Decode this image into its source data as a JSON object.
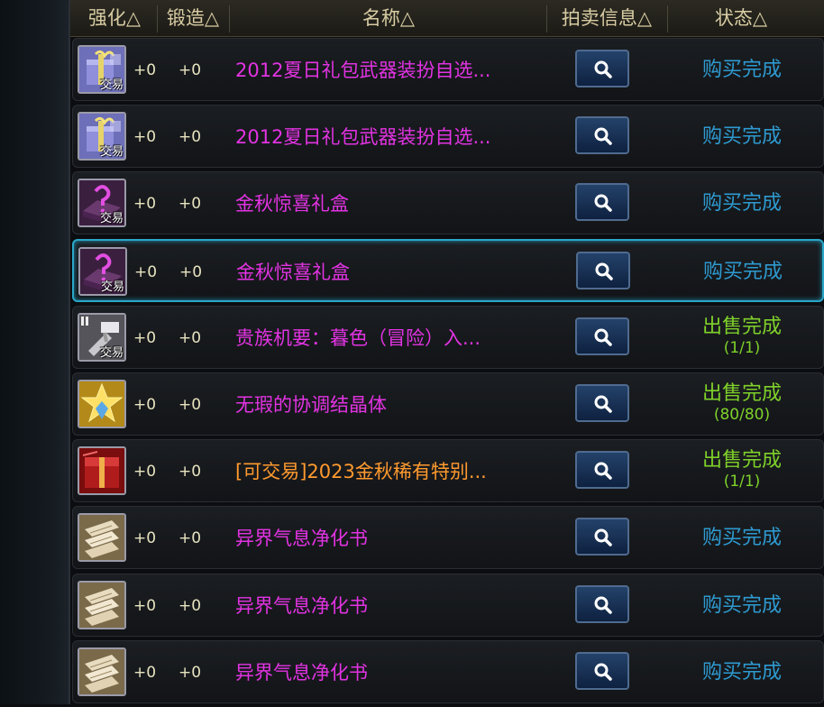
{
  "header": {
    "col_enhance": "强化△",
    "col_forge": "锻造△",
    "col_name": "名称△",
    "col_auction": "拍卖信息△",
    "col_status": "状态△"
  },
  "colors": {
    "name_pink": "#e233e2",
    "name_orange": "#ff9a2e",
    "status_blue": "#2e9ad0",
    "status_green": "#7fd12a",
    "selected_border": "#2aa7c8"
  },
  "rows": [
    {
      "icon": "gift-box-ribbon-icon",
      "trade": "交易",
      "enhance": "+0",
      "forge": "+0",
      "name": "2012夏日礼包武器装扮自选...",
      "name_color": "pink",
      "status": "购买完成",
      "sub": "",
      "status_color": "blue"
    },
    {
      "icon": "gift-box-ribbon-icon",
      "trade": "交易",
      "enhance": "+0",
      "forge": "+0",
      "name": "2012夏日礼包武器装扮自选...",
      "name_color": "pink",
      "status": "购买完成",
      "sub": "",
      "status_color": "blue"
    },
    {
      "icon": "mystery-box-icon",
      "trade": "交易",
      "enhance": "+0",
      "forge": "+0",
      "name": "金秋惊喜礼盒",
      "name_color": "pink",
      "status": "购买完成",
      "sub": "",
      "status_color": "blue"
    },
    {
      "icon": "mystery-box-icon",
      "trade": "交易",
      "enhance": "+0",
      "forge": "+0",
      "name": "金秋惊喜礼盒",
      "name_color": "pink",
      "status": "购买完成",
      "sub": "",
      "status_color": "blue"
    },
    {
      "icon": "silver-hammer-icon",
      "trade": "交易",
      "enhance": "+0",
      "forge": "+0",
      "name": "贵族机要：暮色（冒险）入...",
      "name_color": "pink",
      "status": "出售完成",
      "sub": "(1/1)",
      "status_color": "green"
    },
    {
      "icon": "star-crystal-icon",
      "trade": "",
      "enhance": "+0",
      "forge": "+0",
      "name": "无瑕的协调结晶体",
      "name_color": "pink",
      "status": "出售完成",
      "sub": "(80/80)",
      "status_color": "green"
    },
    {
      "icon": "red-chest-icon",
      "trade": "",
      "enhance": "+0",
      "forge": "+0",
      "name": "[可交易]2023金秋稀有特别...",
      "name_color": "orange",
      "status": "出售完成",
      "sub": "(1/1)",
      "status_color": "green"
    },
    {
      "icon": "scroll-icon",
      "trade": "",
      "enhance": "+0",
      "forge": "+0",
      "name": "异界气息净化书",
      "name_color": "pink",
      "status": "购买完成",
      "sub": "",
      "status_color": "blue"
    },
    {
      "icon": "scroll-icon",
      "trade": "",
      "enhance": "+0",
      "forge": "+0",
      "name": "异界气息净化书",
      "name_color": "pink",
      "status": "购买完成",
      "sub": "",
      "status_color": "blue"
    },
    {
      "icon": "scroll-icon",
      "trade": "",
      "enhance": "+0",
      "forge": "+0",
      "name": "异界气息净化书",
      "name_color": "pink",
      "status": "购买完成",
      "sub": "",
      "status_color": "blue"
    }
  ]
}
